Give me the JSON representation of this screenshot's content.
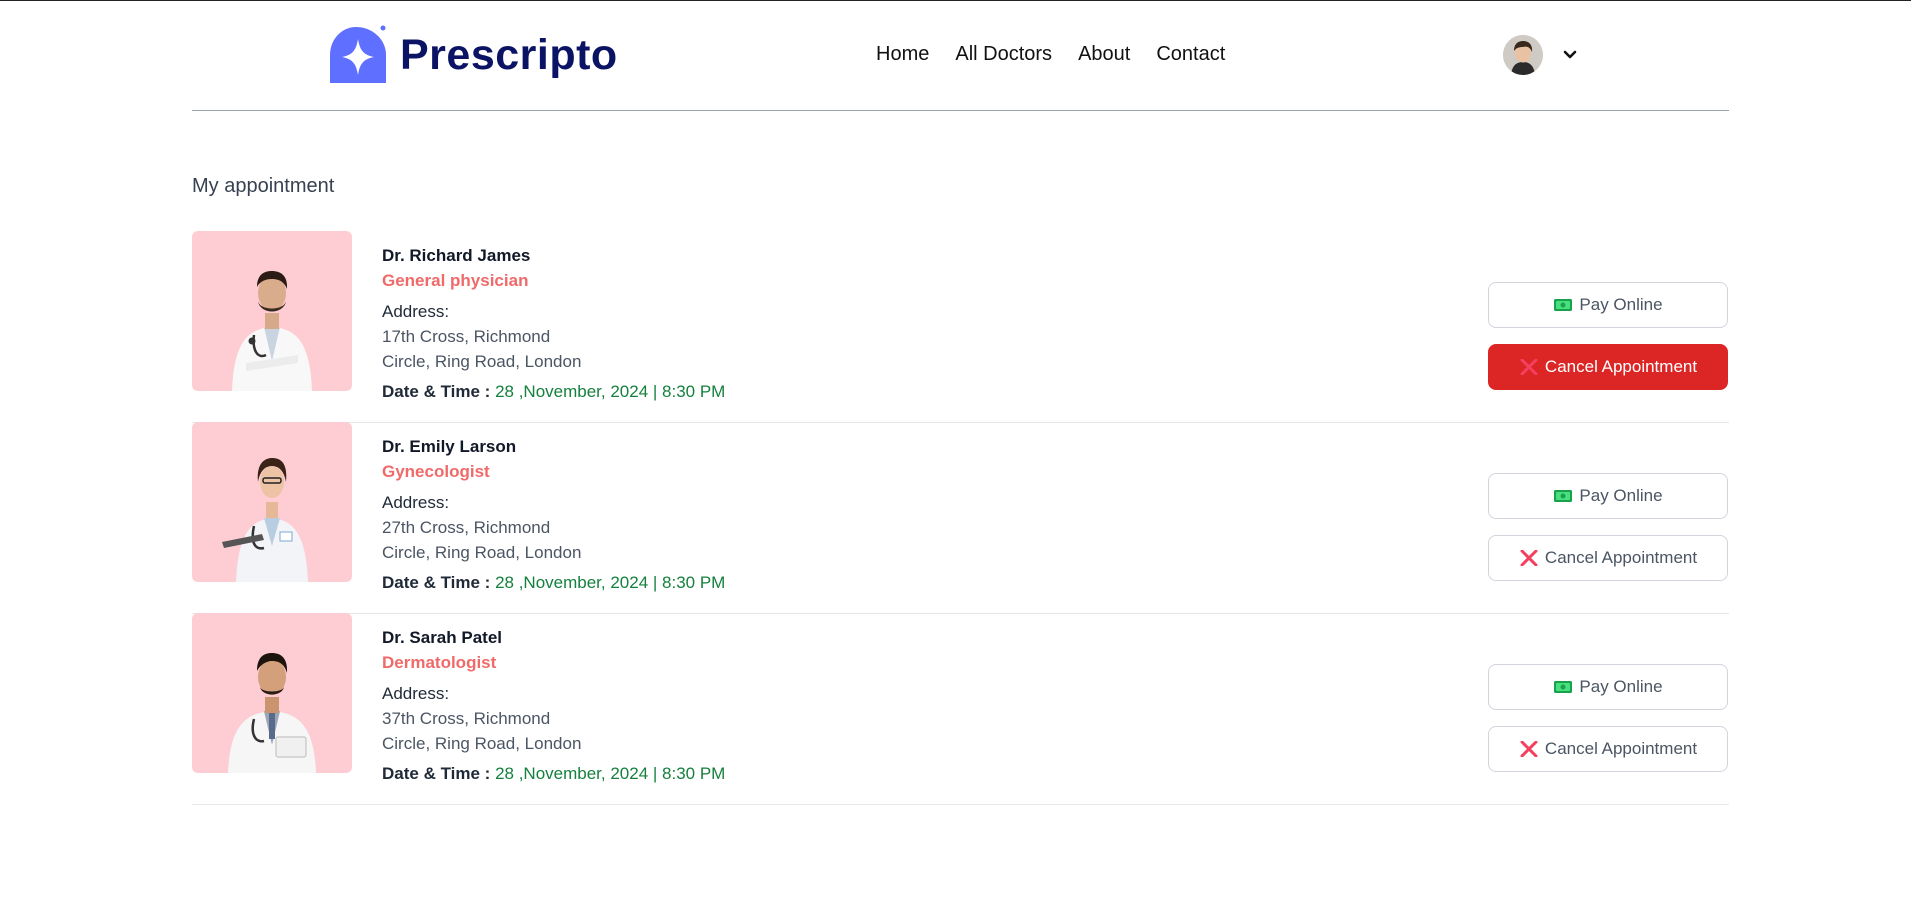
{
  "brand": {
    "name": "Prescripto",
    "color": "#5f6fff"
  },
  "nav": {
    "items": [
      "Home",
      "All Doctors",
      "About",
      "Contact"
    ]
  },
  "page": {
    "title": "My appointment"
  },
  "appointments": [
    {
      "name": "Dr. Richard James",
      "speciality": "General physician",
      "address_label": "Address:",
      "address_line1": "17th Cross, Richmond",
      "address_line2": "Circle, Ring Road, London",
      "datetime_label": "Date & Time :",
      "datetime": "28 ,November, 2024 | 8:30 PM",
      "pay_label": "Pay Online",
      "cancel_label": "Cancel Appointment"
    },
    {
      "name": "Dr. Emily Larson",
      "speciality": "Gynecologist",
      "address_label": "Address:",
      "address_line1": "27th Cross, Richmond",
      "address_line2": "Circle, Ring Road, London",
      "datetime_label": "Date & Time :",
      "datetime": "28 ,November, 2024 | 8:30 PM",
      "pay_label": "Pay Online",
      "cancel_label": "Cancel Appointment"
    },
    {
      "name": "Dr. Sarah Patel",
      "speciality": "Dermatologist",
      "address_label": "Address:",
      "address_line1": "37th Cross, Richmond",
      "address_line2": "Circle, Ring Road, London",
      "datetime_label": "Date & Time :",
      "datetime": "28 ,November, 2024 | 8:30 PM",
      "pay_label": "Pay Online",
      "cancel_label": "Cancel Appointment"
    }
  ],
  "icons": {
    "pay": "money-icon",
    "cancel": "close-icon",
    "profile_menu": "chevron-down-icon"
  },
  "colors": {
    "speciality": "#f06a6a",
    "datetime": "#15803d",
    "cancel_active": "#dc2626",
    "photo_bg": "#fecdd3"
  }
}
